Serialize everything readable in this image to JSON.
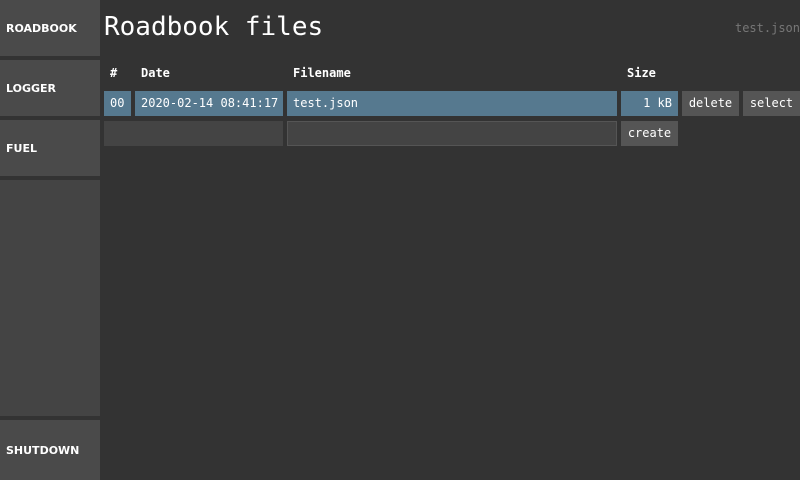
{
  "sidebar": {
    "roadbook": "ROADBOOK",
    "logger": "LOGGER",
    "fuel": "FUEL",
    "shutdown": "SHUTDOWN"
  },
  "header": {
    "title": "Roadbook files",
    "current_file": "test.json"
  },
  "table": {
    "columns": [
      "#",
      "Date",
      "Filename",
      "Size"
    ],
    "rows": [
      {
        "index": "00",
        "date": "2020-02-14 08:41:17",
        "filename": "test.json",
        "size": "1 kB"
      }
    ],
    "actions": {
      "delete": "delete",
      "select": "select",
      "create": "create"
    }
  },
  "colors": {
    "background": "#333333",
    "selected_row": "#56798f",
    "button": "#555555",
    "sidebar": "#4a4a4a"
  }
}
